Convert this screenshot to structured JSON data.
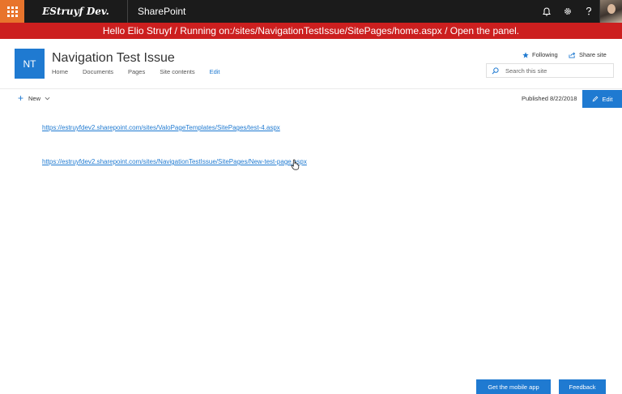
{
  "suitebar": {
    "brand": "EStruyf Dev.",
    "app_name": "SharePoint",
    "icons": [
      "notification-bell-icon",
      "gear-icon",
      "help-icon"
    ],
    "accent": "#e8742c"
  },
  "banner": {
    "text": "Hello Elio Struyf / Running on:/sites/NavigationTestIssue/SitePages/home.aspx / Open the panel.",
    "color": "#cc1f1f"
  },
  "site": {
    "logo_initials": "NT",
    "title": "Navigation Test Issue",
    "nav": {
      "home": "Home",
      "documents": "Documents",
      "pages": "Pages",
      "site_contents": "Site contents",
      "edit": "Edit"
    },
    "following_label": "Following",
    "share_label": "Share site",
    "search_placeholder": "Search this site",
    "theme_color": "#1f7ad1"
  },
  "commandbar": {
    "new_label": "New",
    "published": "Published 8/22/2018",
    "edit_label": "Edit"
  },
  "content": {
    "links": [
      "https://estruyfdev2.sharepoint.com/sites/ValoPageTemplates/SitePages/test-4.aspx",
      "https://estruyfdev2.sharepoint.com/sites/NavigationTestIssue/SitePages/New-test-page.aspx"
    ]
  },
  "footer": {
    "mobile_app": "Get the mobile app",
    "feedback": "Feedback"
  }
}
